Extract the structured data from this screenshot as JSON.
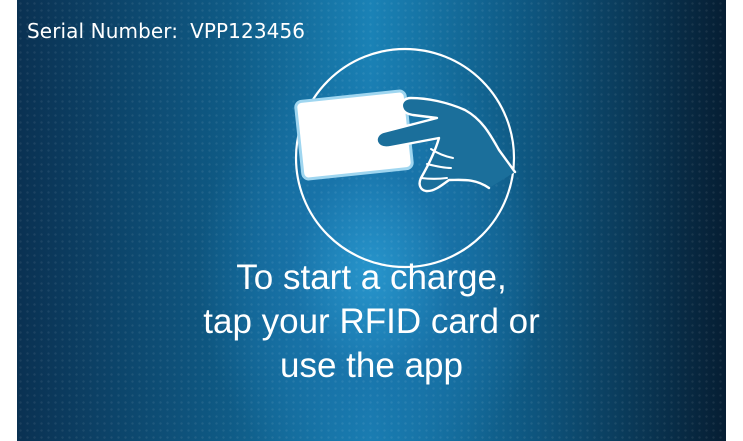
{
  "device": {
    "serial_label": "Serial Number:",
    "serial_value": "VPP123456"
  },
  "prompt": {
    "line1": "To start a charge,",
    "line2": "tap your RFID card or",
    "line3": "use the app"
  },
  "icons": {
    "illustration": "tap-rfid-card-icon"
  },
  "colors": {
    "text": "#ffffff",
    "screen_center": "#1a82b6",
    "screen_edge": "#061e33"
  }
}
